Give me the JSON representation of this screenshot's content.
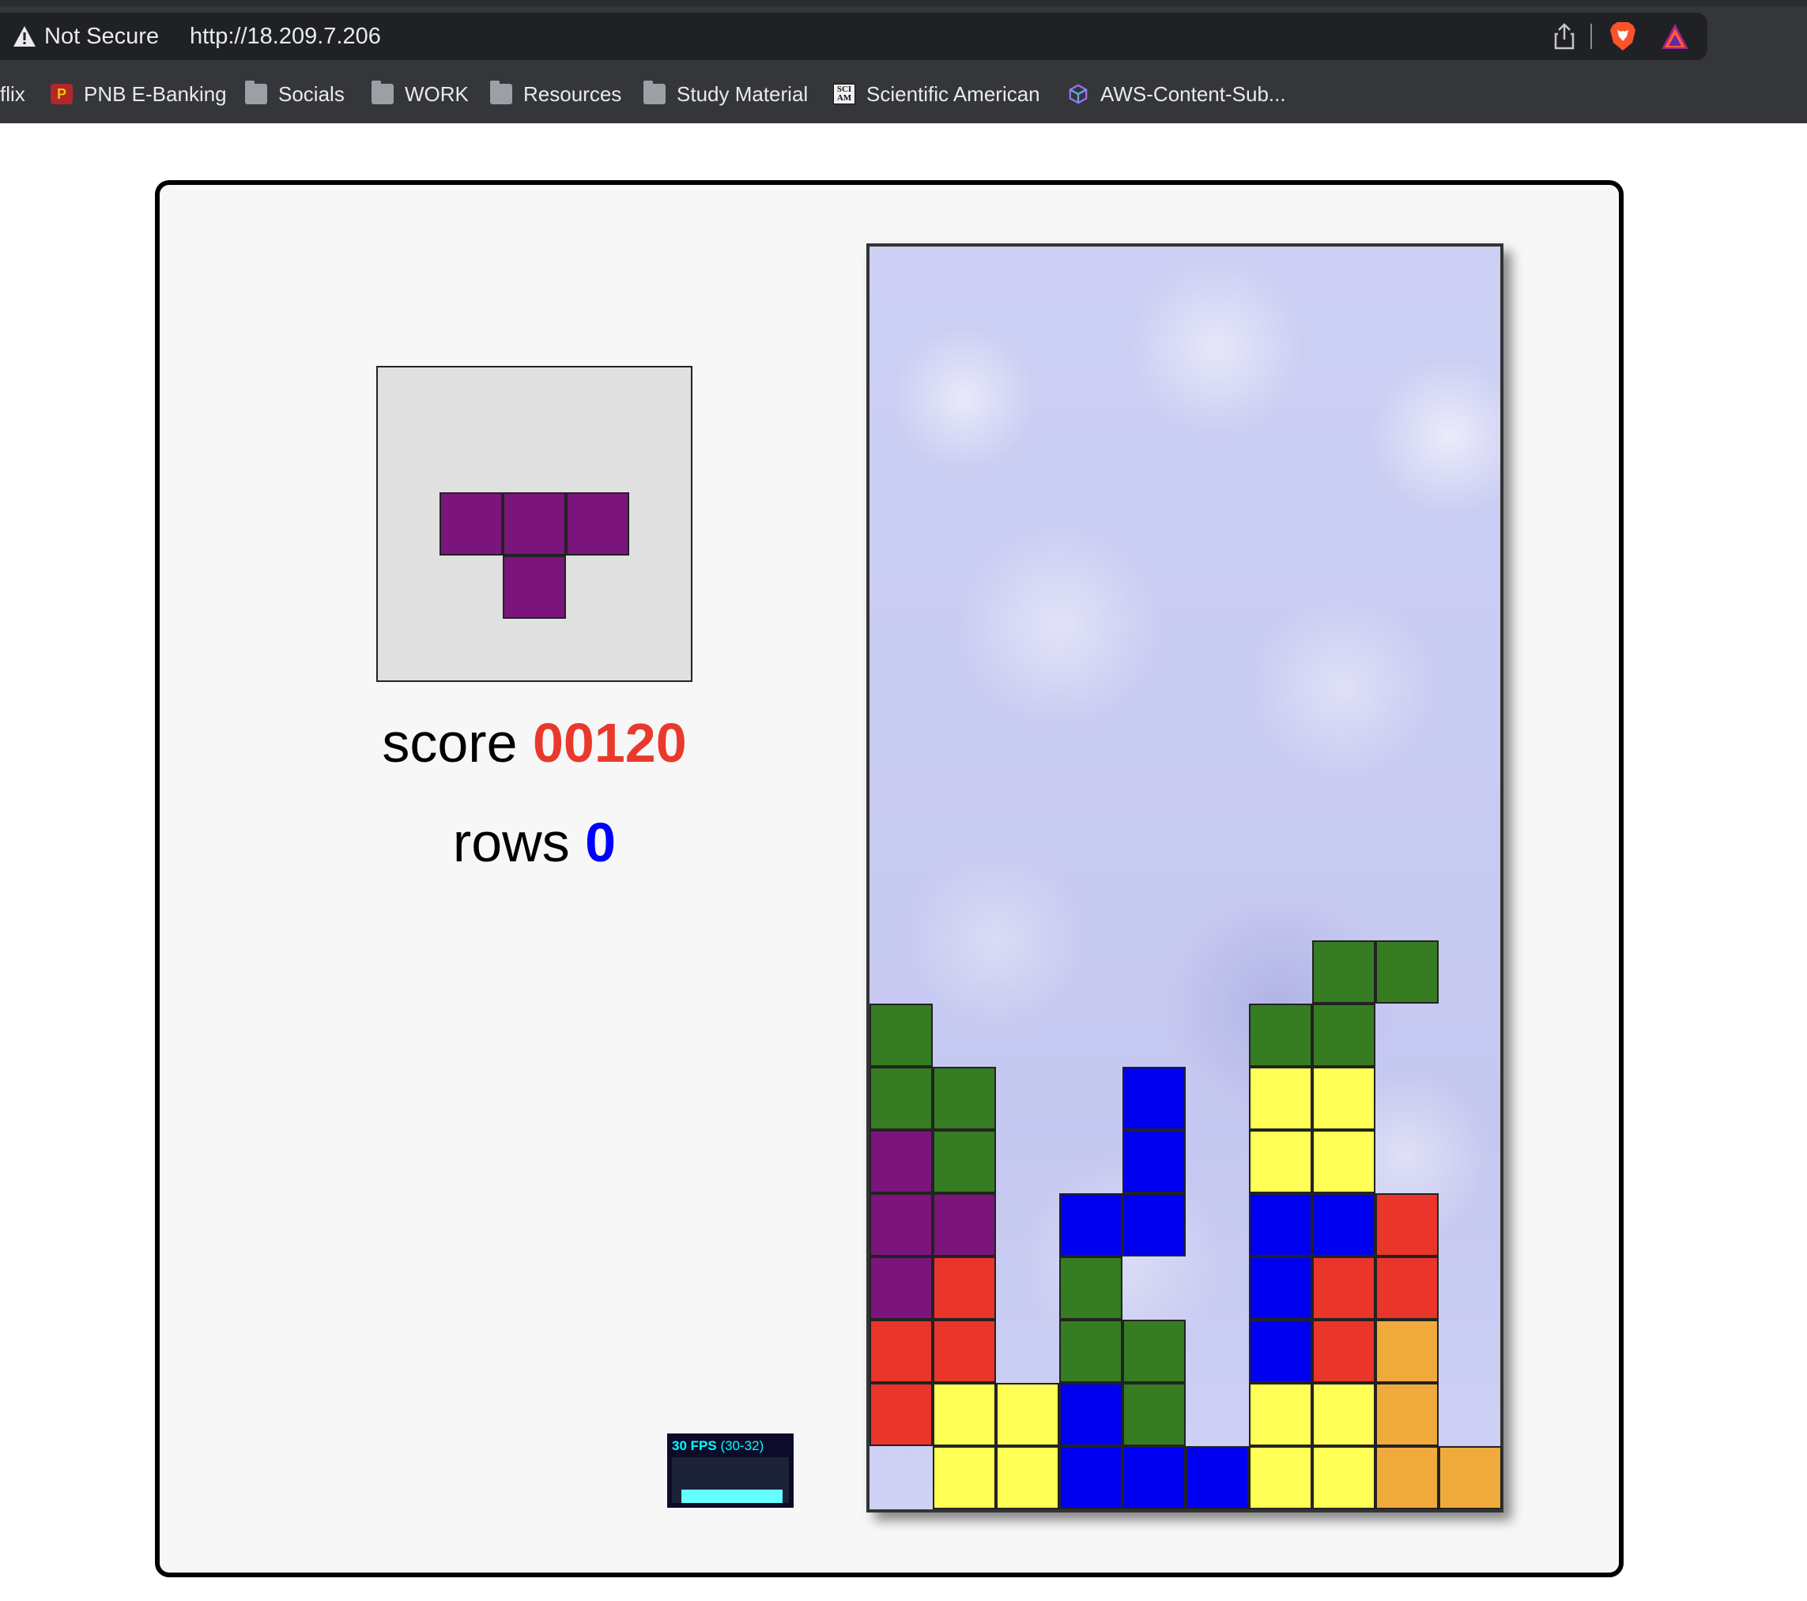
{
  "browser": {
    "security_label": "Not Secure",
    "url": "http://18.209.7.206",
    "icons": [
      "warning-icon",
      "share-icon",
      "brave-shield-icon",
      "brave-rewards-icon"
    ]
  },
  "bookmarks": [
    {
      "label": "flix",
      "icon": "none"
    },
    {
      "label": "PNB E-Banking",
      "icon": "pnb-icon"
    },
    {
      "label": "Socials",
      "icon": "folder-icon"
    },
    {
      "label": "WORK",
      "icon": "folder-icon"
    },
    {
      "label": "Resources",
      "icon": "folder-icon"
    },
    {
      "label": "Study Material",
      "icon": "folder-icon"
    },
    {
      "label": "Scientific American",
      "icon": "sciam-icon"
    },
    {
      "label": "AWS-Content-Sub...",
      "icon": "aws-cube-icon"
    }
  ],
  "game": {
    "score_label": "score",
    "score_value": "00120",
    "rows_label": "rows",
    "rows_value": "0",
    "fps": {
      "label": "30 FPS",
      "range": "(30-32)",
      "level": 0.17
    },
    "next_piece": {
      "shape": "T",
      "color": "#7b157b"
    },
    "colors": {
      "G": "#367c22",
      "P": "#7b157b",
      "B": "#0000f0",
      "R": "#e9352a",
      "Y": "#ffff55",
      "O": "#f0aa3c"
    },
    "board": {
      "columns": 10,
      "rows": 20,
      "grid": [
        "..........",
        "..........",
        "..........",
        "..........",
        "..........",
        "..........",
        "..........",
        "..........",
        "..........",
        "..........",
        "..........",
        ".......GG.",
        "G.....GG..",
        "GG..B.YY..",
        "PG..B.YY..",
        "PP.BB.BBR.",
        "PR.G..BRR.",
        "RR.GG.BRO.",
        "RYYBG.YYO.",
        ".YYBBBYYOO"
      ]
    }
  }
}
